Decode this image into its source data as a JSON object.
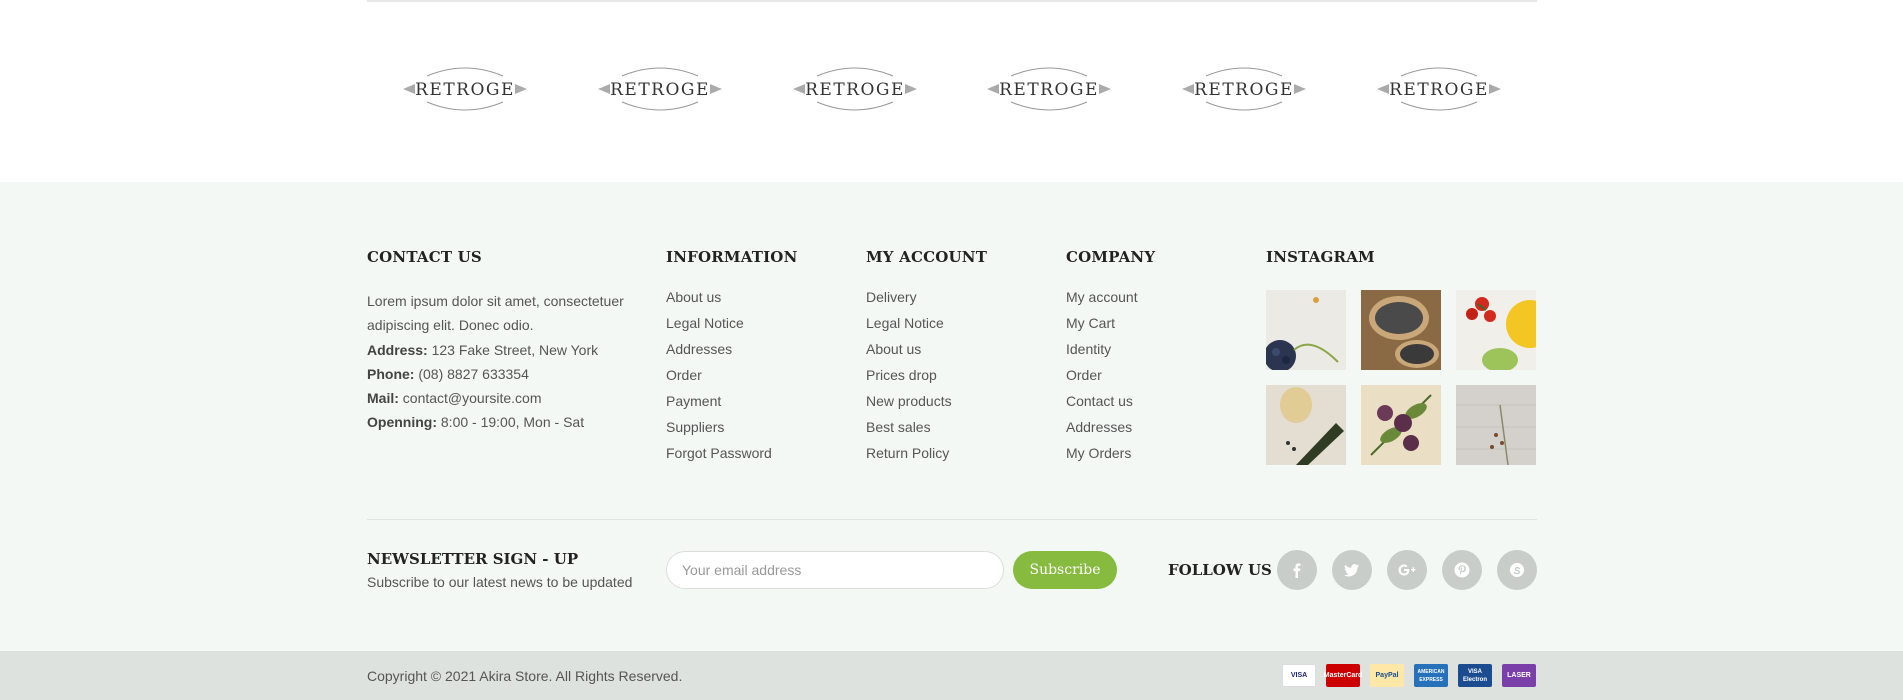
{
  "brands": [
    {
      "name": "RETROGE"
    },
    {
      "name": "RETROGE"
    },
    {
      "name": "RETROGE"
    },
    {
      "name": "RETROGE"
    },
    {
      "name": "RETROGE"
    },
    {
      "name": "RETROGE"
    }
  ],
  "contact": {
    "title": "CONTACT US",
    "intro": "Lorem ipsum dolor sit amet, consectetuer adipiscing elit. Donec odio.",
    "address_label": "Address:",
    "address": "123 Fake Street, New York",
    "phone_label": "Phone:",
    "phone": "(08) 8827 633354",
    "mail_label": "Mail:",
    "mail": "contact@yoursite.com",
    "opening_label": "Openning:",
    "opening": "8:00 - 19:00, Mon - Sat"
  },
  "information": {
    "title": "INFORMATION",
    "links": [
      "About us",
      "Legal Notice",
      "Addresses",
      "Order",
      "Payment",
      "Suppliers",
      "Forgot Password"
    ]
  },
  "my_account": {
    "title": "MY ACCOUNT",
    "links": [
      "Delivery",
      "Legal Notice",
      "About us",
      "Prices drop",
      "New products",
      "Best sales",
      "Return Policy"
    ]
  },
  "company": {
    "title": "COMPANY",
    "links": [
      "My account",
      "My Cart",
      "Identity",
      "Order",
      "Contact us",
      "Addresses",
      "My Orders"
    ]
  },
  "instagram": {
    "title": "INSTAGRAM",
    "photos": [
      "blueberries-photo",
      "chia-seeds-photo",
      "tomatoes-photo",
      "zucchini-photo",
      "figs-photo",
      "herbs-photo"
    ]
  },
  "newsletter": {
    "title": "NEWSLETTER SIGN - UP",
    "subtitle": "Subscribe to our latest news to be updated",
    "placeholder": "Your email address",
    "button": "Subscribe"
  },
  "follow": {
    "title": "FOLLOW US",
    "icons": [
      "facebook-icon",
      "twitter-icon",
      "google-plus-icon",
      "pinterest-icon",
      "skype-icon"
    ]
  },
  "copyright": "Copyright © 2021 Akira Store. All Rights Reserved.",
  "payments": [
    {
      "name": "VISA",
      "color": "#1a1f71",
      "bg": "#ffffff"
    },
    {
      "name": "MasterCard",
      "color": "#ffffff",
      "bg": "#cc0000"
    },
    {
      "name": "PayPal",
      "color": "#1a4a8a",
      "bg": "#ffe7a8"
    },
    {
      "name": "AMERICAN EXPRESS",
      "color": "#ffffff",
      "bg": "#2671b9"
    },
    {
      "name": "VISA Electron",
      "color": "#ffffff",
      "bg": "#1a4c8f"
    },
    {
      "name": "LASER",
      "color": "#ffffff",
      "bg": "#7a3fa8"
    }
  ],
  "colors": {
    "accent": "#86bb3f",
    "footer_bg": "#f3f8f5",
    "bottom_bar": "#dde2df"
  }
}
